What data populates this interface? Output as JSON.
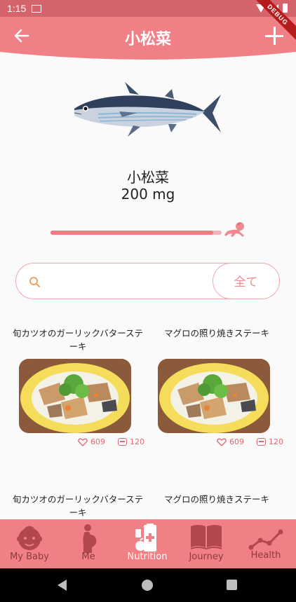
{
  "status_bar": {
    "time": "1:15",
    "debug_label": "DEBUG"
  },
  "header": {
    "title": "小松菜"
  },
  "food": {
    "name": "小松菜",
    "amount": "200 mg",
    "progress": 0.95
  },
  "search": {
    "placeholder": "",
    "value": "",
    "filter_button": "全て"
  },
  "recipes": [
    {
      "title": "旬カツオのガーリックバターステーキ",
      "likes": "609",
      "comments": "120"
    },
    {
      "title": "マグロの照り焼きステーキ",
      "likes": "609",
      "comments": "120"
    },
    {
      "title": "旬カツオのガーリックバターステーキ"
    },
    {
      "title": "マグロの照り焼きステーキ"
    }
  ],
  "bottom_nav": {
    "items": [
      {
        "label": "My Baby",
        "icon": "baby-face-icon"
      },
      {
        "label": "Me",
        "icon": "pregnant-woman-icon"
      },
      {
        "label": "Nutrition",
        "icon": "nutrition-icon",
        "active": true
      },
      {
        "label": "Journey",
        "icon": "book-icon"
      },
      {
        "label": "Health",
        "icon": "chart-line-icon"
      }
    ]
  },
  "colors": {
    "primary": "#f17f86",
    "status": "#d4636c",
    "accent": "#f08a90",
    "nav_inactive": "#8a3b42"
  }
}
